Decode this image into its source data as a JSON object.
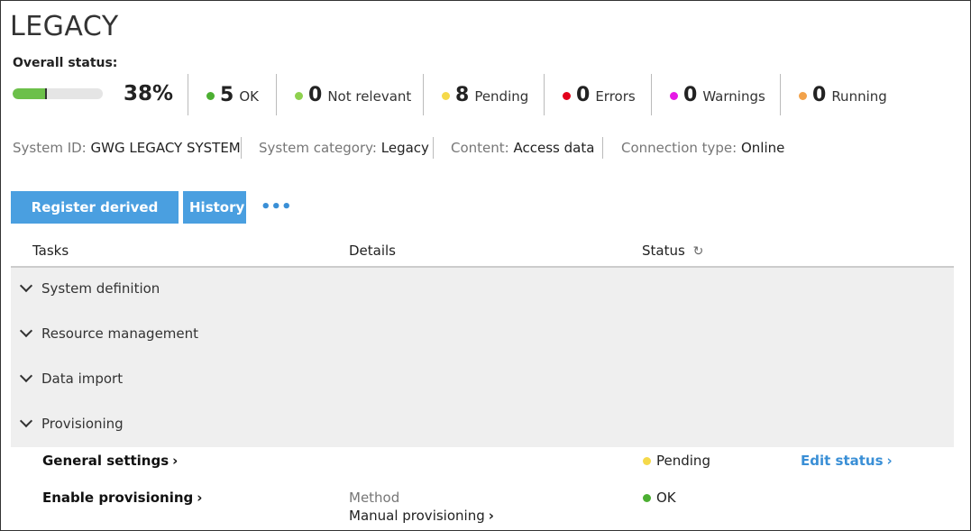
{
  "header": {
    "title": "LEGACY",
    "overall_label": "Overall status:"
  },
  "overall": {
    "progress_fraction": 0.38,
    "percent_text": "38%",
    "stats": [
      {
        "count": "5",
        "label": "OK",
        "color": "#4caf32"
      },
      {
        "count": "0",
        "label": "Not relevant",
        "color": "#8fd14f"
      },
      {
        "count": "8",
        "label": "Pending",
        "color": "#f5d94a"
      },
      {
        "count": "0",
        "label": "Errors",
        "color": "#e3001b"
      },
      {
        "count": "0",
        "label": "Warnings",
        "color": "#e619e6"
      },
      {
        "count": "0",
        "label": "Running",
        "color": "#f2a24a"
      }
    ]
  },
  "meta": [
    {
      "key": "System ID:",
      "value": "GWG LEGACY SYSTEM"
    },
    {
      "key": "System category:",
      "value": "Legacy"
    },
    {
      "key": "Content:",
      "value": "Access data"
    },
    {
      "key": "Connection type:",
      "value": "Online"
    }
  ],
  "toolbar": {
    "register_label": "Register derived system",
    "history_label": "History",
    "more_label": "•••"
  },
  "table": {
    "headers": {
      "tasks": "Tasks",
      "details": "Details",
      "status": "Status"
    },
    "groups": [
      "System definition",
      "Resource management",
      "Data import",
      "Provisioning"
    ],
    "rows": [
      {
        "task": "General settings",
        "detail_key": "",
        "detail_value": "",
        "status": "Pending",
        "status_color": "#f5d94a",
        "action": "Edit status"
      },
      {
        "task": "Enable provisioning",
        "detail_key": "Method",
        "detail_value": "Manual provisioning",
        "status": "OK",
        "status_color": "#4caf32",
        "action": ""
      }
    ]
  }
}
